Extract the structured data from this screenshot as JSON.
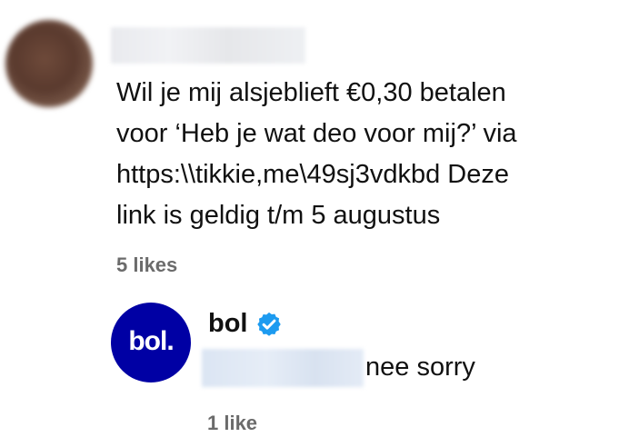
{
  "comment": {
    "text_lines": [
      "Wil je mij alsjeblieft €0,30 betalen",
      "voor ‘Heb je wat deo voor mij?’ via",
      "https:\\\\tikkie,me\\49sj3vdkbd Deze",
      "link is geldig t/m 5 augustus"
    ],
    "likes": "5 likes"
  },
  "reply": {
    "avatar_text": "bol.",
    "author": "bol",
    "text": "nee sorry",
    "likes": "1 like"
  },
  "colors": {
    "brand": "#0000a4",
    "verified": "#1d9bf0",
    "muted": "#6b6b6b"
  },
  "icons": {
    "verified": "verified-badge-icon"
  }
}
